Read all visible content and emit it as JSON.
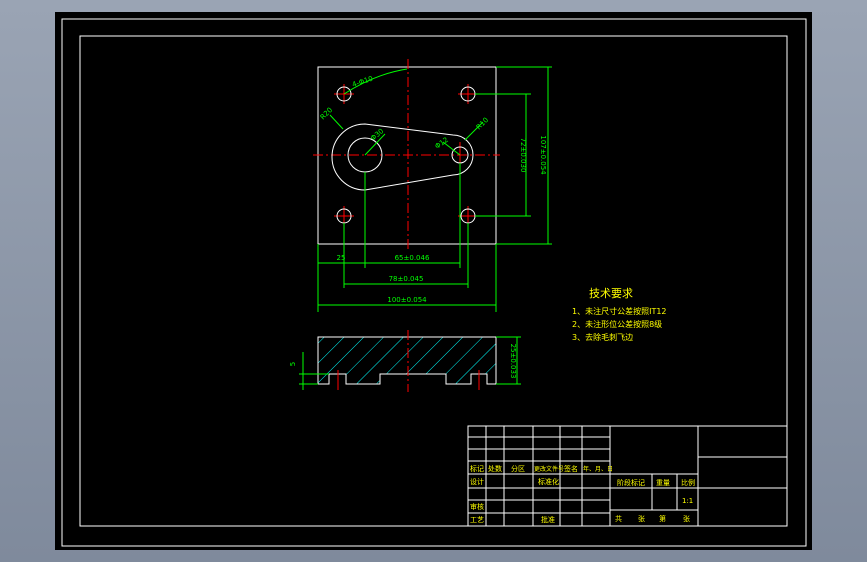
{
  "colors": {
    "background": "#000000",
    "frame": "#ffffff",
    "dimension": "#00ff00",
    "centerline": "#ff0000",
    "outline": "#ffffff",
    "text": "#ffff00",
    "hatch": "#00ffff"
  },
  "dimensions": {
    "hole_pattern": "4-Φ10",
    "r1": "R20",
    "phi1": "Φ30",
    "phi2": "Φ12",
    "r2": "R10",
    "h_inner": "72±0.030",
    "h_outer": "107±0.054",
    "w_left": "25",
    "w_65": "65±0.046",
    "w_78": "78±0.045",
    "w_total": "100±0.054",
    "thickness": "25±0.033",
    "step": "5"
  },
  "notes": {
    "title": "技术要求",
    "items": [
      "1、未注尺寸公差按照IT12",
      "2、未注形位公差按照8级",
      "3、去除毛刺飞边"
    ]
  },
  "titleblock": {
    "mark": "标记",
    "count": "处数",
    "zone": "分区",
    "change_doc": "更改文件号",
    "signature": "签名",
    "date": "年、月、日",
    "design": "设计",
    "standardize": "标准化",
    "stage_mark": "阶段标记",
    "weight": "重量",
    "scale": "比例",
    "scale_value": "1:1",
    "review": "审核",
    "process": "工艺",
    "approve": "批准",
    "sheet_total": "共",
    "sheets": "张",
    "sheet_no": "第",
    "sheet_word": "张"
  }
}
